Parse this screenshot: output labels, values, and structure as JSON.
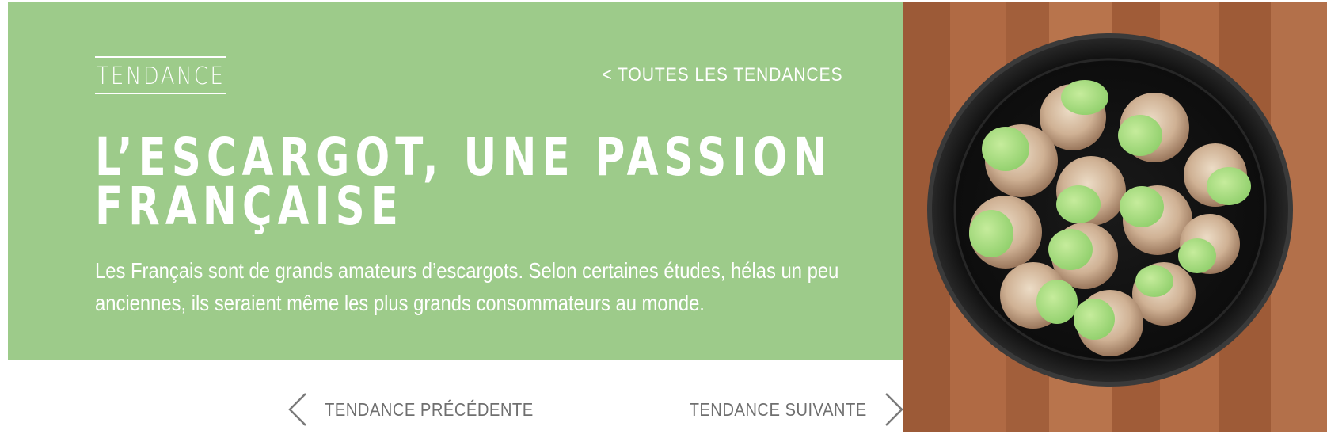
{
  "hero": {
    "eyebrow": "TENDANCE",
    "all_trends_link": "< TOUTES LES TENDANCES",
    "title_line1": "L’ESCARGOT, UNE PASSION",
    "title_line2": "FRANÇAISE",
    "lead": "Les Français sont de grands amateurs d’escargots. Selon certaines études, hélas un peu anciennes, ils seraient même les plus grands consommateurs au monde.",
    "background_color": "#9dcb8a"
  },
  "pagination": {
    "prev_label": "TENDANCE PRÉCÉDENTE",
    "next_label": "TENDANCE SUIVANTE",
    "prev_icon": "chevron-left-icon",
    "next_icon": "chevron-right-icon"
  },
  "image": {
    "subject": "escargots-plate-photo"
  }
}
